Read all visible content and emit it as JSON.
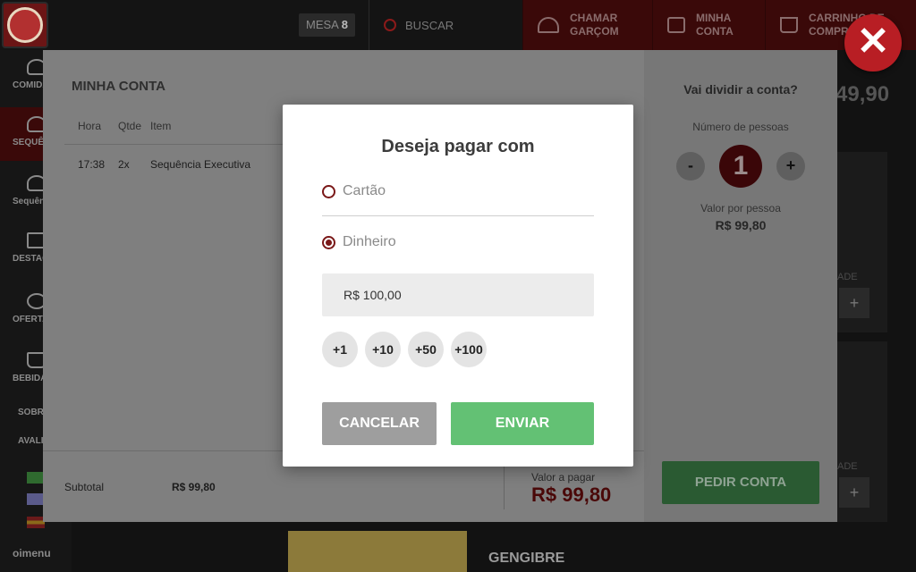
{
  "topbar": {
    "mesa_label": "MESA",
    "mesa_number": "8",
    "search_label": "BUSCAR",
    "call_waiter_line1": "CHAMAR",
    "call_waiter_line2": "GARÇOM",
    "my_account_line1": "MINHA",
    "my_account_line2": "CONTA",
    "cart_line1": "CARRINHO DE",
    "cart_line2": "COMPRAS"
  },
  "sidebar": {
    "items": [
      {
        "label": "COMIDAS"
      },
      {
        "label": "SEQUÊNCIAS"
      },
      {
        "label": "Sequências"
      },
      {
        "label": "DESTAQUES"
      },
      {
        "label": "OFERTAS"
      },
      {
        "label": "BEBIDAS"
      },
      {
        "label": "SOBRE"
      },
      {
        "label": "AVALIAR"
      }
    ],
    "footer": "oimenu"
  },
  "background": {
    "price_partial": "49,90",
    "qty_label": "QUANTIDADE",
    "item_name": "GENGIBRE"
  },
  "account_panel": {
    "title": "MINHA CONTA",
    "columns": {
      "hora": "Hora",
      "qtde": "Qtde",
      "item": "Item"
    },
    "rows": [
      {
        "hora": "17:38",
        "qtde": "2x",
        "item": "Sequência Executiva"
      }
    ],
    "subtotal_label": "Subtotal",
    "subtotal_value": "R$ 99,80",
    "pay_label": "Valor a pagar",
    "pay_value": "R$ 99,80"
  },
  "split": {
    "title": "Vai dividir a conta?",
    "people_label": "Número de pessoas",
    "minus": "-",
    "plus": "+",
    "count": "1",
    "per_person_label": "Valor por pessoa",
    "per_person_value": "R$ 99,80",
    "request_bill": "PEDIR CONTA"
  },
  "dialog": {
    "title": "Deseja pagar com",
    "option_card": "Cartão",
    "option_cash": "Dinheiro",
    "selected": "cash",
    "amount": "R$ 100,00",
    "quick_adds": [
      "+1",
      "+10",
      "+50",
      "+100"
    ],
    "cancel": "CANCELAR",
    "send": "ENVIAR"
  },
  "colors": {
    "brand_red": "#7a1818",
    "send_green": "#63c174",
    "cancel_grey": "#9e9e9e"
  }
}
